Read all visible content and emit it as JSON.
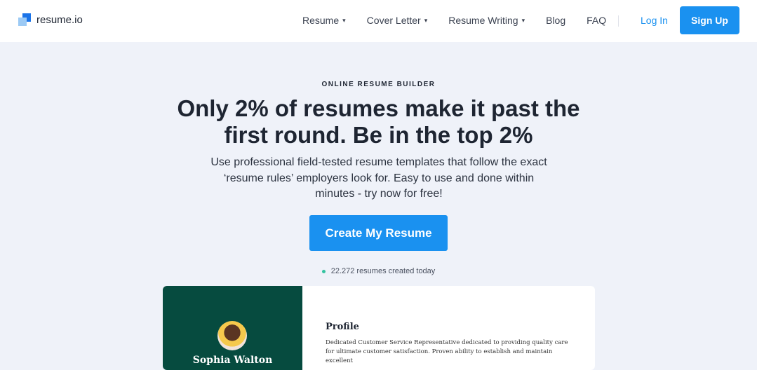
{
  "header": {
    "logo": "resume.io",
    "nav": [
      "Resume",
      "Cover Letter",
      "Resume Writing",
      "Blog",
      "FAQ"
    ],
    "login": "Log In",
    "signup": "Sign Up"
  },
  "hero": {
    "eyebrow": "ONLINE RESUME BUILDER",
    "title": "Only 2% of resumes make it past the first round. Be in the top 2%",
    "subtitle": "Use professional field-tested resume templates that follow the exact ‘resume rules’ employers look for. Easy to use and done within minutes - try now for free!",
    "cta": "Create My Resume",
    "count": "22.272 resumes created today"
  },
  "preview": {
    "name": "Sophia Walton",
    "profile_heading": "Profile",
    "profile_text": "Dedicated Customer Service Representative dedicated to providing quality care for ultimate customer satisfaction. Proven ability to establish and maintain excellent"
  },
  "colors": {
    "accent": "#1a91f0",
    "resume_sidebar": "#064b3f"
  }
}
